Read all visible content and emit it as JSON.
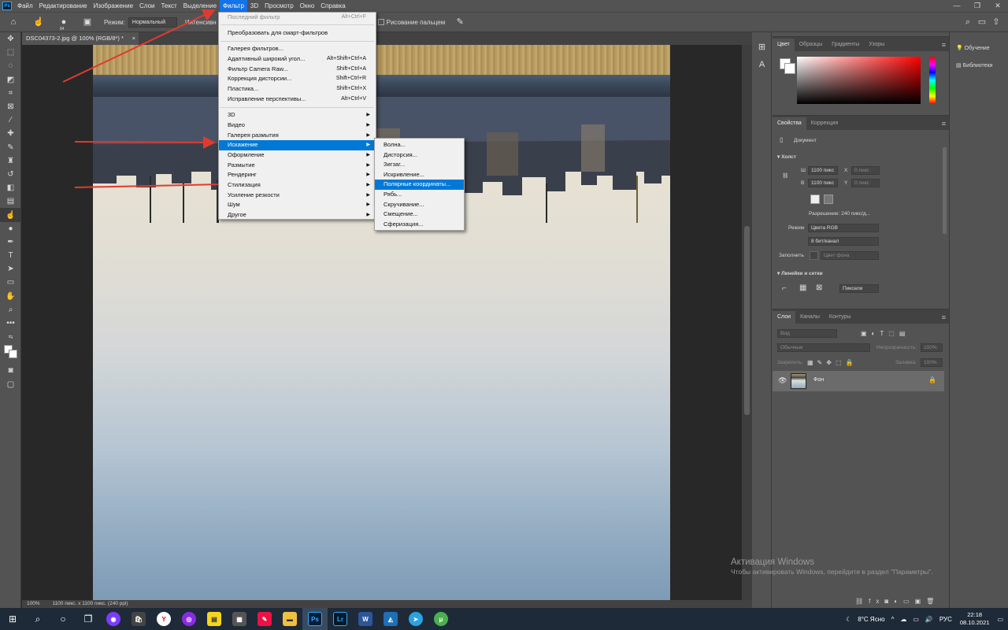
{
  "menubar": {
    "items": [
      "Файл",
      "Редактирование",
      "Изображение",
      "Слои",
      "Текст",
      "Выделение",
      "Фильтр",
      "3D",
      "Просмотр",
      "Окно",
      "Справка"
    ],
    "active": "Фильтр"
  },
  "optionsbar": {
    "brush_size": "84",
    "mode_label": "Режим:",
    "mode_value": "Нормальный",
    "intensity_label": "Интенсивн",
    "finger_label": "Рисование пальцем"
  },
  "document": {
    "tab_title": "DSC04373-2.jpg @ 100% (RGB/8*) *",
    "zoom": "100%",
    "info": "1100 пикс. x 1100 пикс. (240 ppi)"
  },
  "filter_menu": {
    "items": [
      {
        "label": "Последний фильтр",
        "shortcut": "Alt+Ctrl+F",
        "disabled": true
      },
      {
        "label": "Преобразовать для смарт-фильтров",
        "shortcut": ""
      },
      {
        "label": "Галерея фильтров...",
        "shortcut": ""
      },
      {
        "label": "Адаптивный широкий угол...",
        "shortcut": "Alt+Shift+Ctrl+A"
      },
      {
        "label": "Фильтр Camera Raw...",
        "shortcut": "Shift+Ctrl+A"
      },
      {
        "label": "Коррекция дисторсии...",
        "shortcut": "Shift+Ctrl+R"
      },
      {
        "label": "Пластика...",
        "shortcut": "Shift+Ctrl+X"
      },
      {
        "label": "Исправление перспективы...",
        "shortcut": "Alt+Ctrl+V"
      },
      {
        "label": "3D",
        "submenu": true
      },
      {
        "label": "Видео",
        "submenu": true
      },
      {
        "label": "Галерея размытия",
        "submenu": true
      },
      {
        "label": "Искажение",
        "submenu": true,
        "highlighted": true
      },
      {
        "label": "Оформление",
        "submenu": true
      },
      {
        "label": "Размытие",
        "submenu": true
      },
      {
        "label": "Рендеринг",
        "submenu": true
      },
      {
        "label": "Стилизация",
        "submenu": true
      },
      {
        "label": "Усиление резкости",
        "submenu": true
      },
      {
        "label": "Шум",
        "submenu": true
      },
      {
        "label": "Другое",
        "submenu": true
      }
    ]
  },
  "distort_submenu": {
    "items": [
      "Волна...",
      "Дисторсия...",
      "Зигзаг...",
      "Искривление...",
      "Полярные координаты...",
      "Рябь...",
      "Скручивание...",
      "Смещение...",
      "Сферизация..."
    ],
    "highlighted": "Полярные координаты..."
  },
  "color_panel": {
    "tabs": [
      "Цвет",
      "Образцы",
      "Градиенты",
      "Узоры"
    ],
    "active": "Цвет",
    "hue": "#ff0000"
  },
  "properties_panel": {
    "tabs": [
      "Свойства",
      "Коррекция"
    ],
    "doc_label": "Документ",
    "canvas_section": "Холст",
    "w_label": "Ш",
    "w_value": "1100 пикс",
    "h_label": "В",
    "h_value": "1100 пикс",
    "x_label": "X",
    "x_placeholder": "0 пикс",
    "y_label": "Y",
    "y_placeholder": "0 пикс",
    "resolution": "Разрешение: 240 пикс/д...",
    "mode_label": "Режим",
    "mode_value": "Цвета RGB",
    "depth_value": "8 бит/канал",
    "fill_label": "Заполнить",
    "fill_value": "Цвет фона",
    "rulers_section": "Линейки и сетки",
    "units_value": "Пиксели"
  },
  "layers_panel": {
    "tabs": [
      "Слои",
      "Каналы",
      "Контуры"
    ],
    "search_placeholder": "Вид",
    "blend": "Обычные",
    "opacity_label": "Непрозрачность:",
    "opacity_value": "100%",
    "lock_label": "Закрепить:",
    "fill_label": "Заливка:",
    "fill_value": "100%",
    "layers": [
      {
        "name": "Фон",
        "locked": true
      }
    ]
  },
  "right_dock": {
    "items": [
      "Обучение",
      "Библиотеки"
    ]
  },
  "activation": {
    "line1": "Активация Windows",
    "line2": "Чтобы активировать Windows, перейдите в раздел \"Параметры\"."
  },
  "taskbar": {
    "weather": "8°С Ясно",
    "lang": "РУС",
    "time": "22:18",
    "date": "08.10.2021"
  }
}
